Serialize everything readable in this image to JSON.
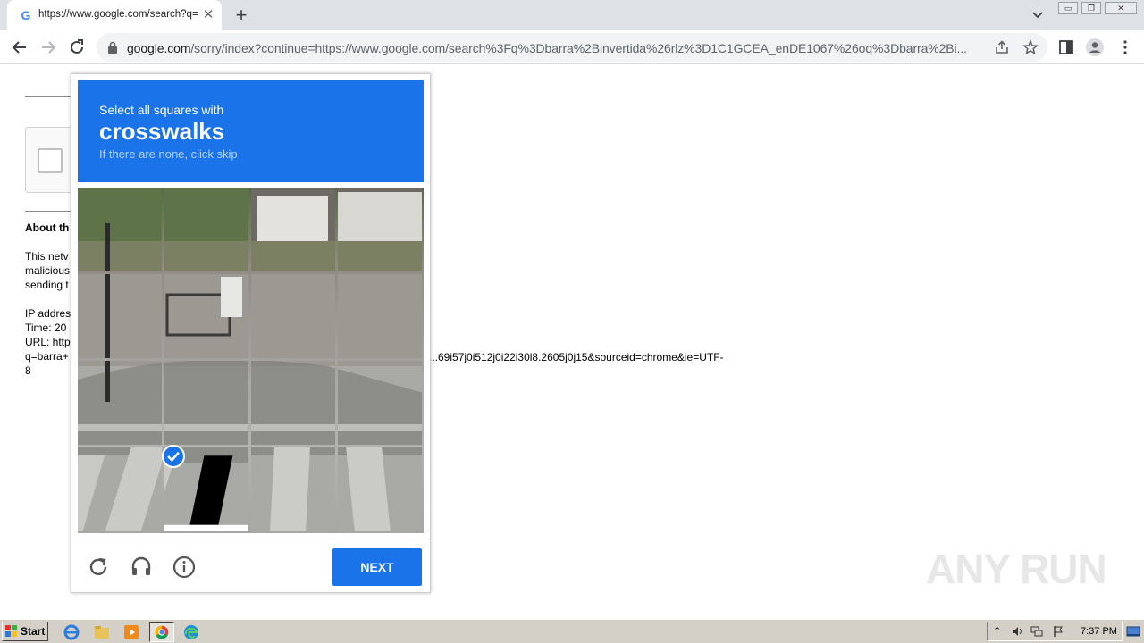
{
  "browser": {
    "tab_title": "https://www.google.com/search?q=",
    "url_host": "google.com",
    "url_path": "/sorry/index?continue=https://www.google.com/search%3Fq%3Dbarra%2Binvertida%26rlz%3D1C1GCEA_enDE1067%26oq%3Dbarra%2Bi..."
  },
  "page": {
    "about_heading": "About th",
    "lines": [
      "This netv",
      "malicious",
      "sending t",
      "IP addres",
      "Time: 20",
      "URL: http",
      "q=barra+",
      "8"
    ],
    "url_tail": "...69i57j0i512j0i22i30l8.2605j0j15&sourceid=chrome&ie=UTF-"
  },
  "captcha": {
    "prompt": "Select all squares with",
    "target": "crosswalks",
    "hint": "If there are none, click skip",
    "next_label": "NEXT",
    "selected_tiles": [
      13
    ]
  },
  "watermark": "ANY RUN",
  "taskbar": {
    "start_label": "Start",
    "clock": "7:37 PM"
  }
}
